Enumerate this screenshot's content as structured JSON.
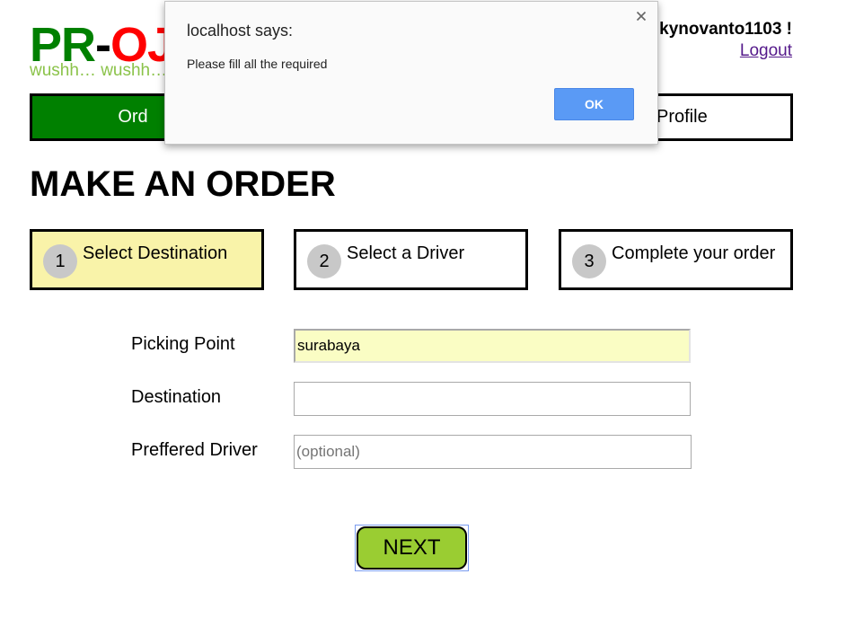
{
  "header": {
    "logo_part1": "PR",
    "logo_dash": "-",
    "logo_part2": "OJI",
    "tagline": "wushh… wushh…",
    "greeting": "kynovanto1103 !",
    "logout": "Logout"
  },
  "nav": {
    "order_label": "Ord",
    "profile_label": "Profile"
  },
  "page_title": "MAKE AN ORDER",
  "steps": [
    {
      "number": "1",
      "label": "Select Destination",
      "active": true
    },
    {
      "number": "2",
      "label": "Select a Driver",
      "active": false
    },
    {
      "number": "3",
      "label": "Complete your order",
      "active": false
    }
  ],
  "form": {
    "picking_point": {
      "label": "Picking Point",
      "value": "surabaya",
      "placeholder": ""
    },
    "destination": {
      "label": "Destination",
      "value": "",
      "placeholder": ""
    },
    "preferred_driver": {
      "label": "Preffered Driver",
      "value": "",
      "placeholder": "(optional)"
    },
    "next_label": "NEXT"
  },
  "dialog": {
    "title": "localhost says:",
    "message": "Please fill all the required",
    "ok_label": "OK",
    "close_icon": "close-icon"
  },
  "colors": {
    "logo_green": "#008000",
    "logo_red": "#ff0000",
    "tagline_green": "#8bc34a",
    "active_step_bg": "#f9f3a9",
    "next_button": "#9acd32",
    "ok_button": "#5a9af5"
  }
}
